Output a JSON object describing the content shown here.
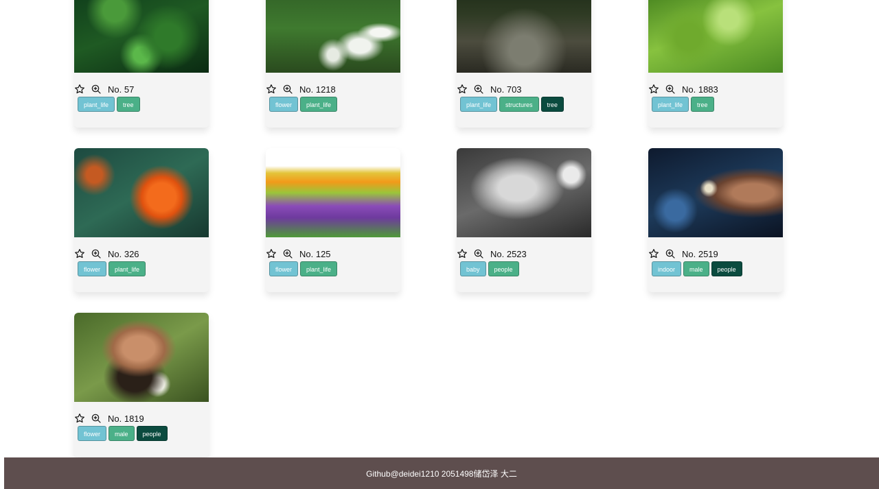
{
  "gallery": {
    "cards": [
      {
        "number": "No. 57",
        "image": "green-bokeh-foliage",
        "tags": [
          {
            "label": "plant_life",
            "style": "c0"
          },
          {
            "label": "tree",
            "style": "c1"
          }
        ]
      },
      {
        "number": "No. 1218",
        "image": "white-flowers-green",
        "tags": [
          {
            "label": "flower",
            "style": "c0"
          },
          {
            "label": "plant_life",
            "style": "c1"
          }
        ]
      },
      {
        "number": "No. 703",
        "image": "forest-path-dark",
        "tags": [
          {
            "label": "plant_life",
            "style": "c0"
          },
          {
            "label": "structures",
            "style": "c1"
          },
          {
            "label": "tree",
            "style": "c2"
          }
        ]
      },
      {
        "number": "No. 1883",
        "image": "maple-leaves",
        "tags": [
          {
            "label": "plant_life",
            "style": "c0"
          },
          {
            "label": "tree",
            "style": "c1"
          }
        ]
      },
      {
        "number": "No. 326",
        "image": "orange-flower",
        "tags": [
          {
            "label": "flower",
            "style": "c0"
          },
          {
            "label": "plant_life",
            "style": "c1"
          }
        ]
      },
      {
        "number": "No. 125",
        "image": "lavender-field",
        "tags": [
          {
            "label": "flower",
            "style": "c0"
          },
          {
            "label": "plant_life",
            "style": "c1"
          }
        ]
      },
      {
        "number": "No. 2523",
        "image": "baby-bw",
        "tags": [
          {
            "label": "baby",
            "style": "c0"
          },
          {
            "label": "people",
            "style": "c1"
          }
        ]
      },
      {
        "number": "No. 2519",
        "image": "man-bokeh-night",
        "tags": [
          {
            "label": "indoor",
            "style": "c0"
          },
          {
            "label": "male",
            "style": "c1"
          },
          {
            "label": "people",
            "style": "c2"
          }
        ]
      },
      {
        "number": "No. 1819",
        "image": "bearded-man-flowers",
        "tags": [
          {
            "label": "flower",
            "style": "c0"
          },
          {
            "label": "male",
            "style": "c1"
          },
          {
            "label": "people",
            "style": "c2"
          }
        ]
      }
    ],
    "icons": {
      "favorite": "star-icon",
      "zoom": "zoom-in-icon"
    }
  },
  "footer": {
    "text": "Github@deidei1210 2051498储岱泽 大二"
  },
  "colors": {
    "tag_light": "#72c3d3",
    "tag_mid": "#4bb088",
    "tag_dark": "#0b4b3f",
    "footer_bg": "#5e4e4e",
    "card_bg": "#f4f4f4"
  }
}
